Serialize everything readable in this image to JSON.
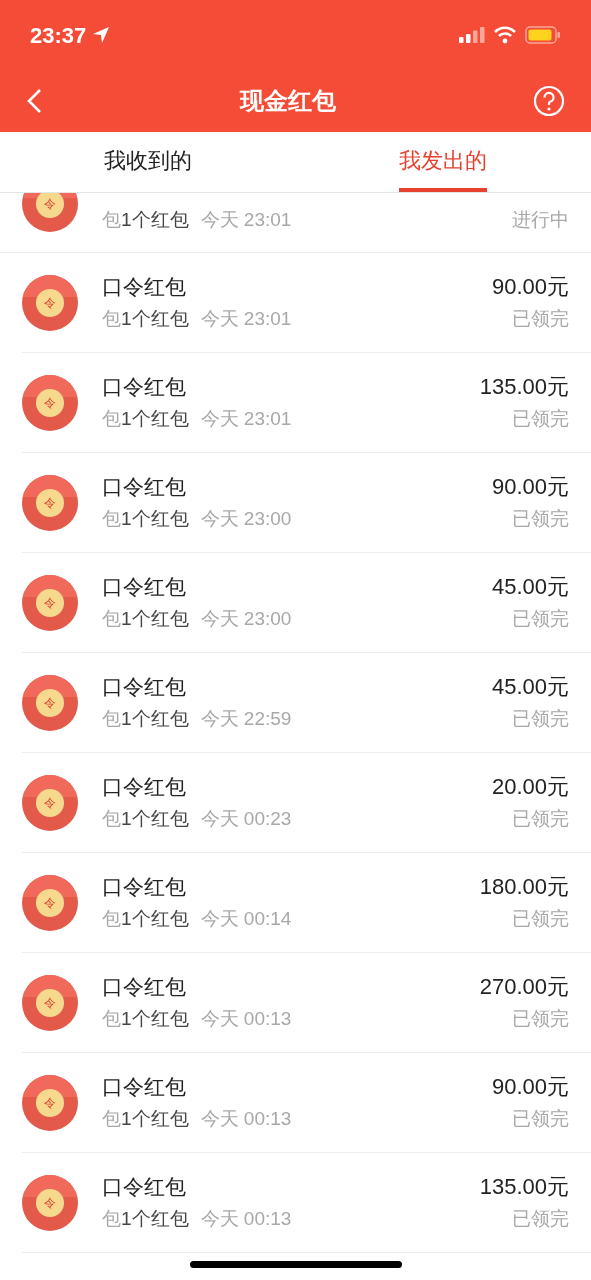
{
  "status_bar": {
    "time": "23:37"
  },
  "nav": {
    "title": "现金红包"
  },
  "tabs": [
    {
      "label": "我收到的",
      "selected": false
    },
    {
      "label": "我发出的",
      "selected": true
    }
  ],
  "rows": [
    {
      "kind": "clipped",
      "icon_char": "令",
      "prefix": "包",
      "count": "1个红包",
      "time": "今天 23:01",
      "status": "进行中"
    },
    {
      "kind": "full",
      "icon_char": "令",
      "title": "口令红包",
      "prefix": "包",
      "count": "1个红包",
      "time": "今天 23:01",
      "amount": "90.00元",
      "status": "已领完"
    },
    {
      "kind": "full",
      "icon_char": "令",
      "title": "口令红包",
      "prefix": "包",
      "count": "1个红包",
      "time": "今天 23:01",
      "amount": "135.00元",
      "status": "已领完"
    },
    {
      "kind": "full",
      "icon_char": "令",
      "title": "口令红包",
      "prefix": "包",
      "count": "1个红包",
      "time": "今天 23:00",
      "amount": "90.00元",
      "status": "已领完"
    },
    {
      "kind": "full",
      "icon_char": "令",
      "title": "口令红包",
      "prefix": "包",
      "count": "1个红包",
      "time": "今天 23:00",
      "amount": "45.00元",
      "status": "已领完"
    },
    {
      "kind": "full",
      "icon_char": "令",
      "title": "口令红包",
      "prefix": "包",
      "count": "1个红包",
      "time": "今天 22:59",
      "amount": "45.00元",
      "status": "已领完"
    },
    {
      "kind": "full",
      "icon_char": "令",
      "title": "口令红包",
      "prefix": "包",
      "count": "1个红包",
      "time": "今天 00:23",
      "amount": "20.00元",
      "status": "已领完"
    },
    {
      "kind": "full",
      "icon_char": "令",
      "title": "口令红包",
      "prefix": "包",
      "count": "1个红包",
      "time": "今天 00:14",
      "amount": "180.00元",
      "status": "已领完"
    },
    {
      "kind": "full",
      "icon_char": "令",
      "title": "口令红包",
      "prefix": "包",
      "count": "1个红包",
      "time": "今天 00:13",
      "amount": "270.00元",
      "status": "已领完"
    },
    {
      "kind": "full",
      "icon_char": "令",
      "title": "口令红包",
      "prefix": "包",
      "count": "1个红包",
      "time": "今天 00:13",
      "amount": "90.00元",
      "status": "已领完"
    },
    {
      "kind": "full",
      "icon_char": "令",
      "title": "口令红包",
      "prefix": "包",
      "count": "1个红包",
      "time": "今天 00:13",
      "amount": "135.00元",
      "status": "已领完"
    }
  ]
}
